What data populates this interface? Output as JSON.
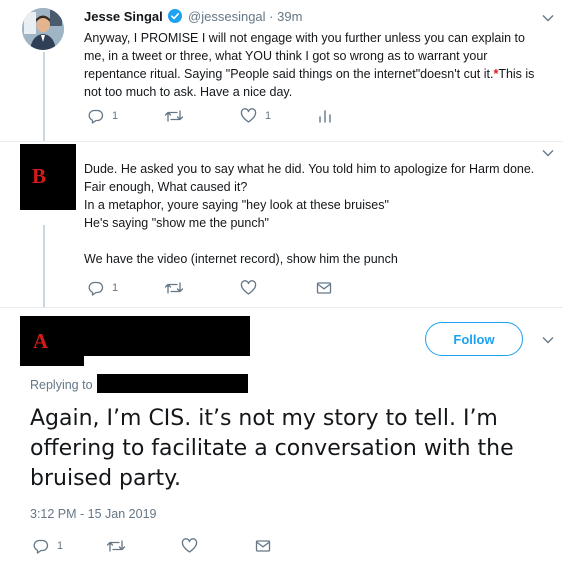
{
  "tweet1": {
    "name": "Jesse Singal",
    "handle": "@jessesingal",
    "time": "· 39m",
    "text": "Anyway, I PROMISE I will not engage with you further unless you can explain to me, in a tweet or three, what YOU think I got so wrong as to warrant your repentance ritual. Saying \"People said things on the internet\"doesn't cut it.",
    "mark": "*",
    "text_after": "This is not too much to ask. Have a nice day.",
    "reply_count": "1",
    "like_count": "1"
  },
  "tweet2": {
    "redaction_label": "B",
    "lines": [
      "Dude. He asked you to say what he did. You told him to apologize for Harm done. Fair enough, What caused it?",
      "In a metaphor, youre saying \"hey look at these bruises\"",
      "He's saying \"show me the punch\"",
      "",
      "We have the video (internet record), show him the punch"
    ],
    "reply_count": "1"
  },
  "tweet3": {
    "redaction_label": "A",
    "follow_label": "Follow",
    "replying_label": "Replying to",
    "text": "Again, I’m CIS. it’s not my story to tell. I’m offering to facilitate a conversation with the bruised party.",
    "timestamp": "3:12 PM - 15 Jan 2019",
    "reply_count": "1"
  },
  "colors": {
    "accent": "#1da1f2",
    "muted": "#657786",
    "redaction_text": "#d41a1a",
    "thread_line": "#ccd6dd"
  },
  "icons": [
    "reply-icon",
    "retweet-icon",
    "like-icon",
    "analytics-icon",
    "message-icon",
    "chevron-down-icon",
    "verified-badge-icon"
  ]
}
